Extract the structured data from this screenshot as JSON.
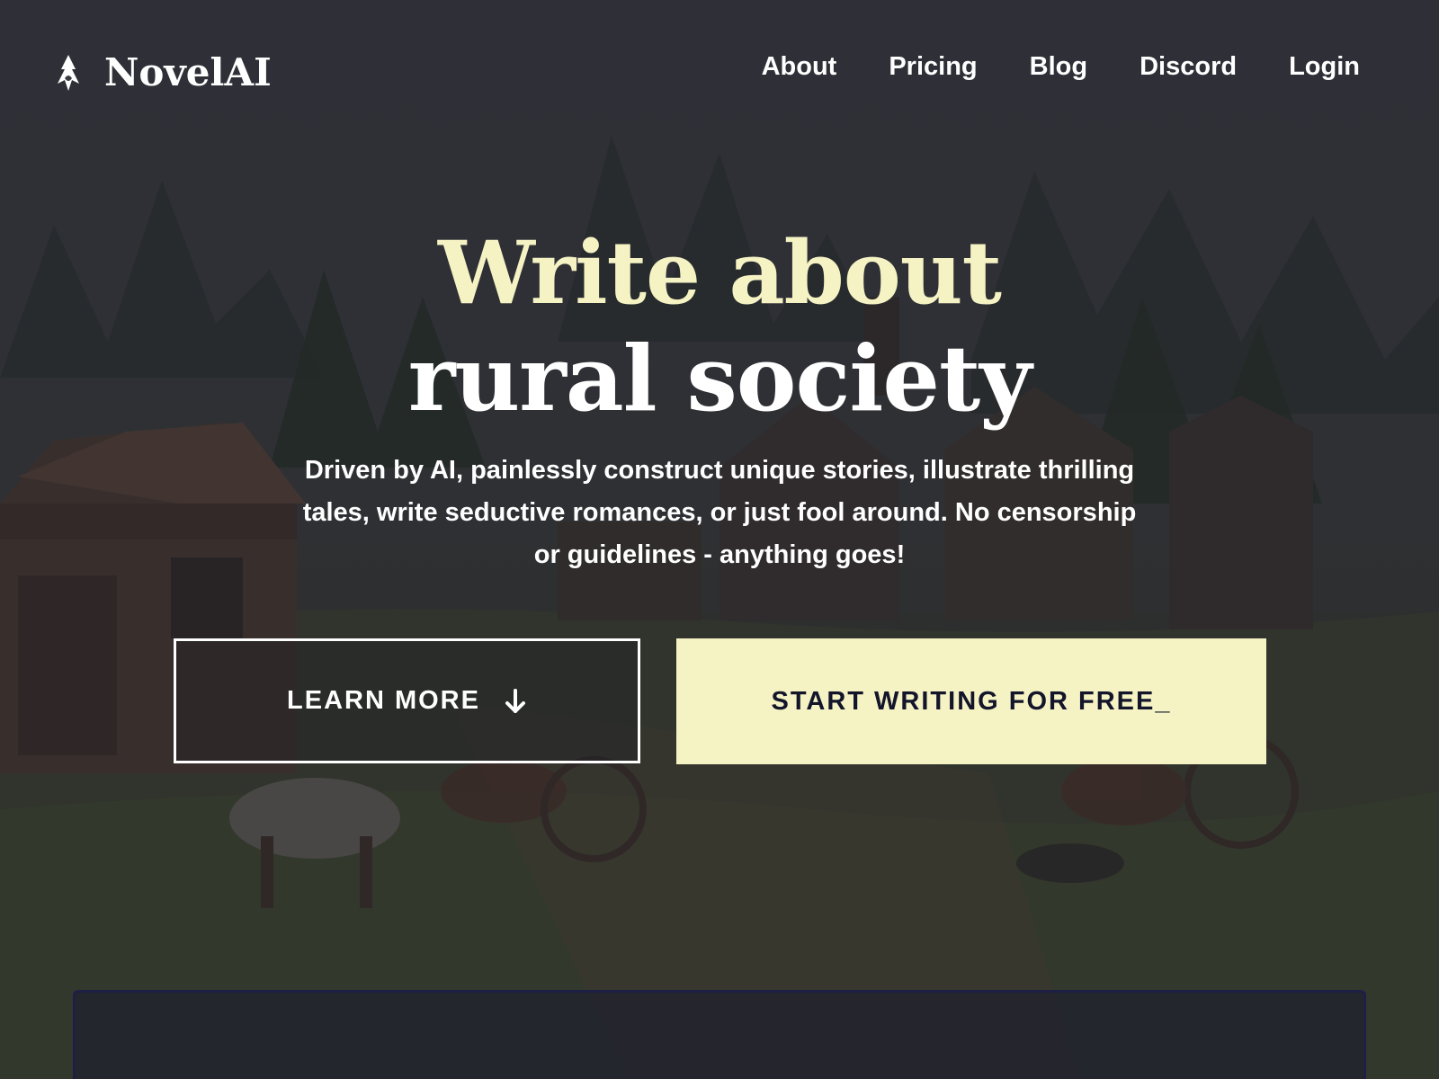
{
  "brand": {
    "name": "NovelAI",
    "icon": "novelai-quill-icon"
  },
  "nav": {
    "items": [
      {
        "label": "About"
      },
      {
        "label": "Pricing"
      },
      {
        "label": "Blog"
      },
      {
        "label": "Discord"
      },
      {
        "label": "Login"
      }
    ]
  },
  "hero": {
    "title_line1": "Write about",
    "title_line2": "rural society",
    "subtitle": "Driven by AI, painlessly construct unique stories, illustrate thrilling tales, write seductive romances, or just fool around. No censorship or guidelines - anything goes!"
  },
  "buttons": {
    "learn_more": "LEARN MORE",
    "learn_more_icon": "arrow-down-icon",
    "start_writing": "START WRITING FOR FREE_"
  },
  "colors": {
    "accent": "#f5f2c4",
    "text": "#ffffff",
    "dark_text": "#13152a",
    "panel_border": "#1d2044"
  }
}
